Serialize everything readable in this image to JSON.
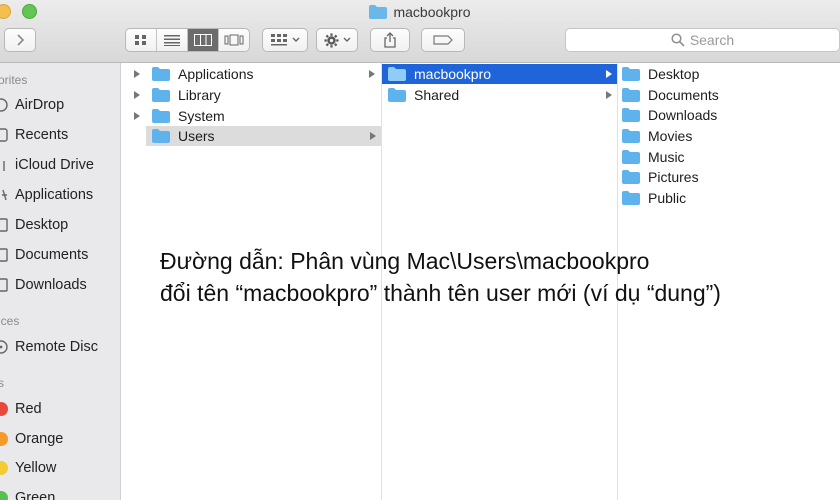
{
  "window": {
    "title": "macbookpro",
    "search_placeholder": "Search"
  },
  "sidebar": {
    "favorites_header": "orites",
    "devices_header": "ices",
    "tags_header": "s",
    "favorites": [
      {
        "label": "AirDrop",
        "icon": "airdrop-icon"
      },
      {
        "label": "Recents",
        "icon": "recents-icon"
      },
      {
        "label": "iCloud Drive",
        "icon": "icloud-icon"
      },
      {
        "label": "Applications",
        "icon": "applications-icon"
      },
      {
        "label": "Desktop",
        "icon": "desktop-icon"
      },
      {
        "label": "Documents",
        "icon": "documents-icon"
      },
      {
        "label": "Downloads",
        "icon": "downloads-icon"
      }
    ],
    "devices": [
      {
        "label": "Remote Disc",
        "icon": "disc-icon"
      }
    ],
    "tags": [
      {
        "label": "Red",
        "color": "#e8493f"
      },
      {
        "label": "Orange",
        "color": "#f39a2b"
      },
      {
        "label": "Yellow",
        "color": "#f3cd2f"
      },
      {
        "label": "Green",
        "color": "#5ac151"
      }
    ]
  },
  "columns": {
    "col1": [
      "Applications",
      "Library",
      "System",
      "Users"
    ],
    "col2": [
      "macbookpro",
      "Shared"
    ],
    "col3": [
      "Desktop",
      "Documents",
      "Downloads",
      "Movies",
      "Music",
      "Pictures",
      "Public"
    ]
  },
  "caption": {
    "line1": "Đường dẫn: Phân vùng Mac\\Users\\macbookpro",
    "line2": "đổi tên “macbookpro” thành tên user mới (ví dụ “dung”)"
  },
  "colors": {
    "selection_blue": "#1f64d8",
    "folder_blue": "#5fb3ec"
  }
}
